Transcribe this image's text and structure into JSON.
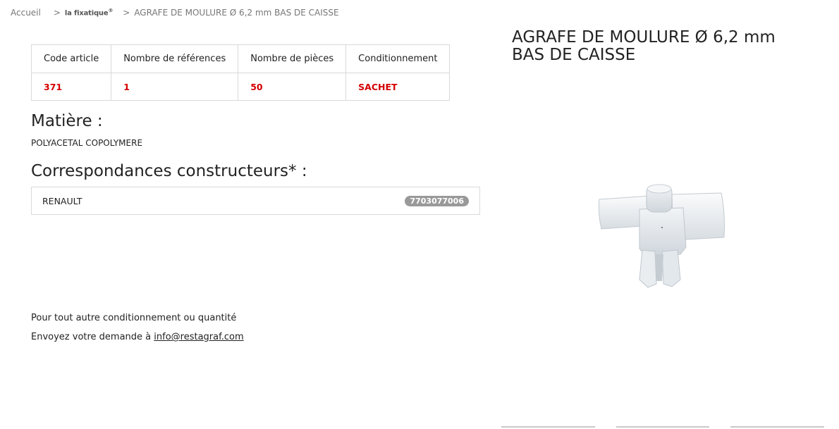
{
  "breadcrumb": {
    "home": "Accueil",
    "separator": ">",
    "brand": "la fixatique",
    "brand_mark": "®",
    "current": "AGRAFE DE MOULURE Ø 6,2 mm BAS DE CAISSE"
  },
  "spec_table": {
    "headers": [
      "Code article",
      "Nombre de références",
      "Nombre de pièces",
      "Conditionnement"
    ],
    "row": [
      "371",
      "1",
      "50",
      "SACHET"
    ]
  },
  "matiere": {
    "heading": "Matière :",
    "value": "POLYACETAL COPOLYMERE"
  },
  "correspondances": {
    "heading": "Correspondances constructeurs* :",
    "items": [
      {
        "brand": "RENAULT",
        "reference": "7703077006"
      }
    ]
  },
  "contact": {
    "line1": "Pour tout autre conditionnement ou quantité",
    "line2_prefix": "Envoyez votre demande à ",
    "email": "info@restagraf.com"
  },
  "product": {
    "title": "AGRAFE DE MOULURE Ø 6,2 mm BAS DE CAISSE",
    "image_icon": "plastic-clip-image"
  },
  "colors": {
    "accent_red": "#d40000",
    "badge_grey": "#999999",
    "border": "#d9d9d9"
  }
}
